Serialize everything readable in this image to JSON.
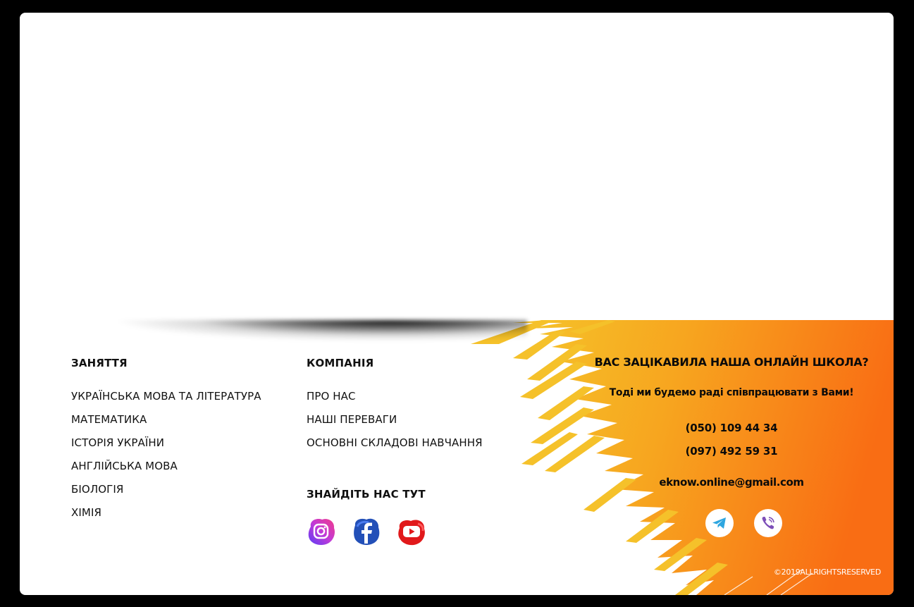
{
  "footer": {
    "classes": {
      "title": "ЗАНЯТТЯ",
      "items": [
        "УКРАЇНСЬКА МОВА ТА ЛІТЕРАТУРА",
        "МАТЕМАТИКА",
        "ІСТОРІЯ УКРАЇНИ",
        "АНГЛІЙСЬКА МОВА",
        "БІОЛОГІЯ",
        "ХІМІЯ"
      ]
    },
    "company": {
      "title": "КОМПАНІЯ",
      "items": [
        "ПРО НАС",
        "НАШІ ПЕРЕВАГИ",
        "ОСНОВНІ СКЛАДОВІ НАВЧАННЯ"
      ]
    },
    "find_us": {
      "title": "ЗНАЙДІТЬ НАС ТУТ",
      "icons": [
        "instagram-icon",
        "facebook-icon",
        "youtube-icon"
      ]
    },
    "cta": {
      "title": "ВАС ЗАЦІКАВИЛА НАША ОНЛАЙН ШКОЛА?",
      "subtitle": "Тоді ми будемо раді співпрацювати з Вами!",
      "phone_1": "(050)  109 44 34",
      "phone_2": "(097)  492 59 31",
      "email": "eknow.online@gmail.com",
      "messengers": [
        "telegram-icon",
        "viber-icon"
      ]
    },
    "copyright": "©2019ALLRIGHTSRESERVED"
  },
  "colors": {
    "background": "#000000",
    "card": "#ffffff",
    "orange": "#f97316",
    "yellow": "#f5c12a",
    "text": "#111111"
  }
}
